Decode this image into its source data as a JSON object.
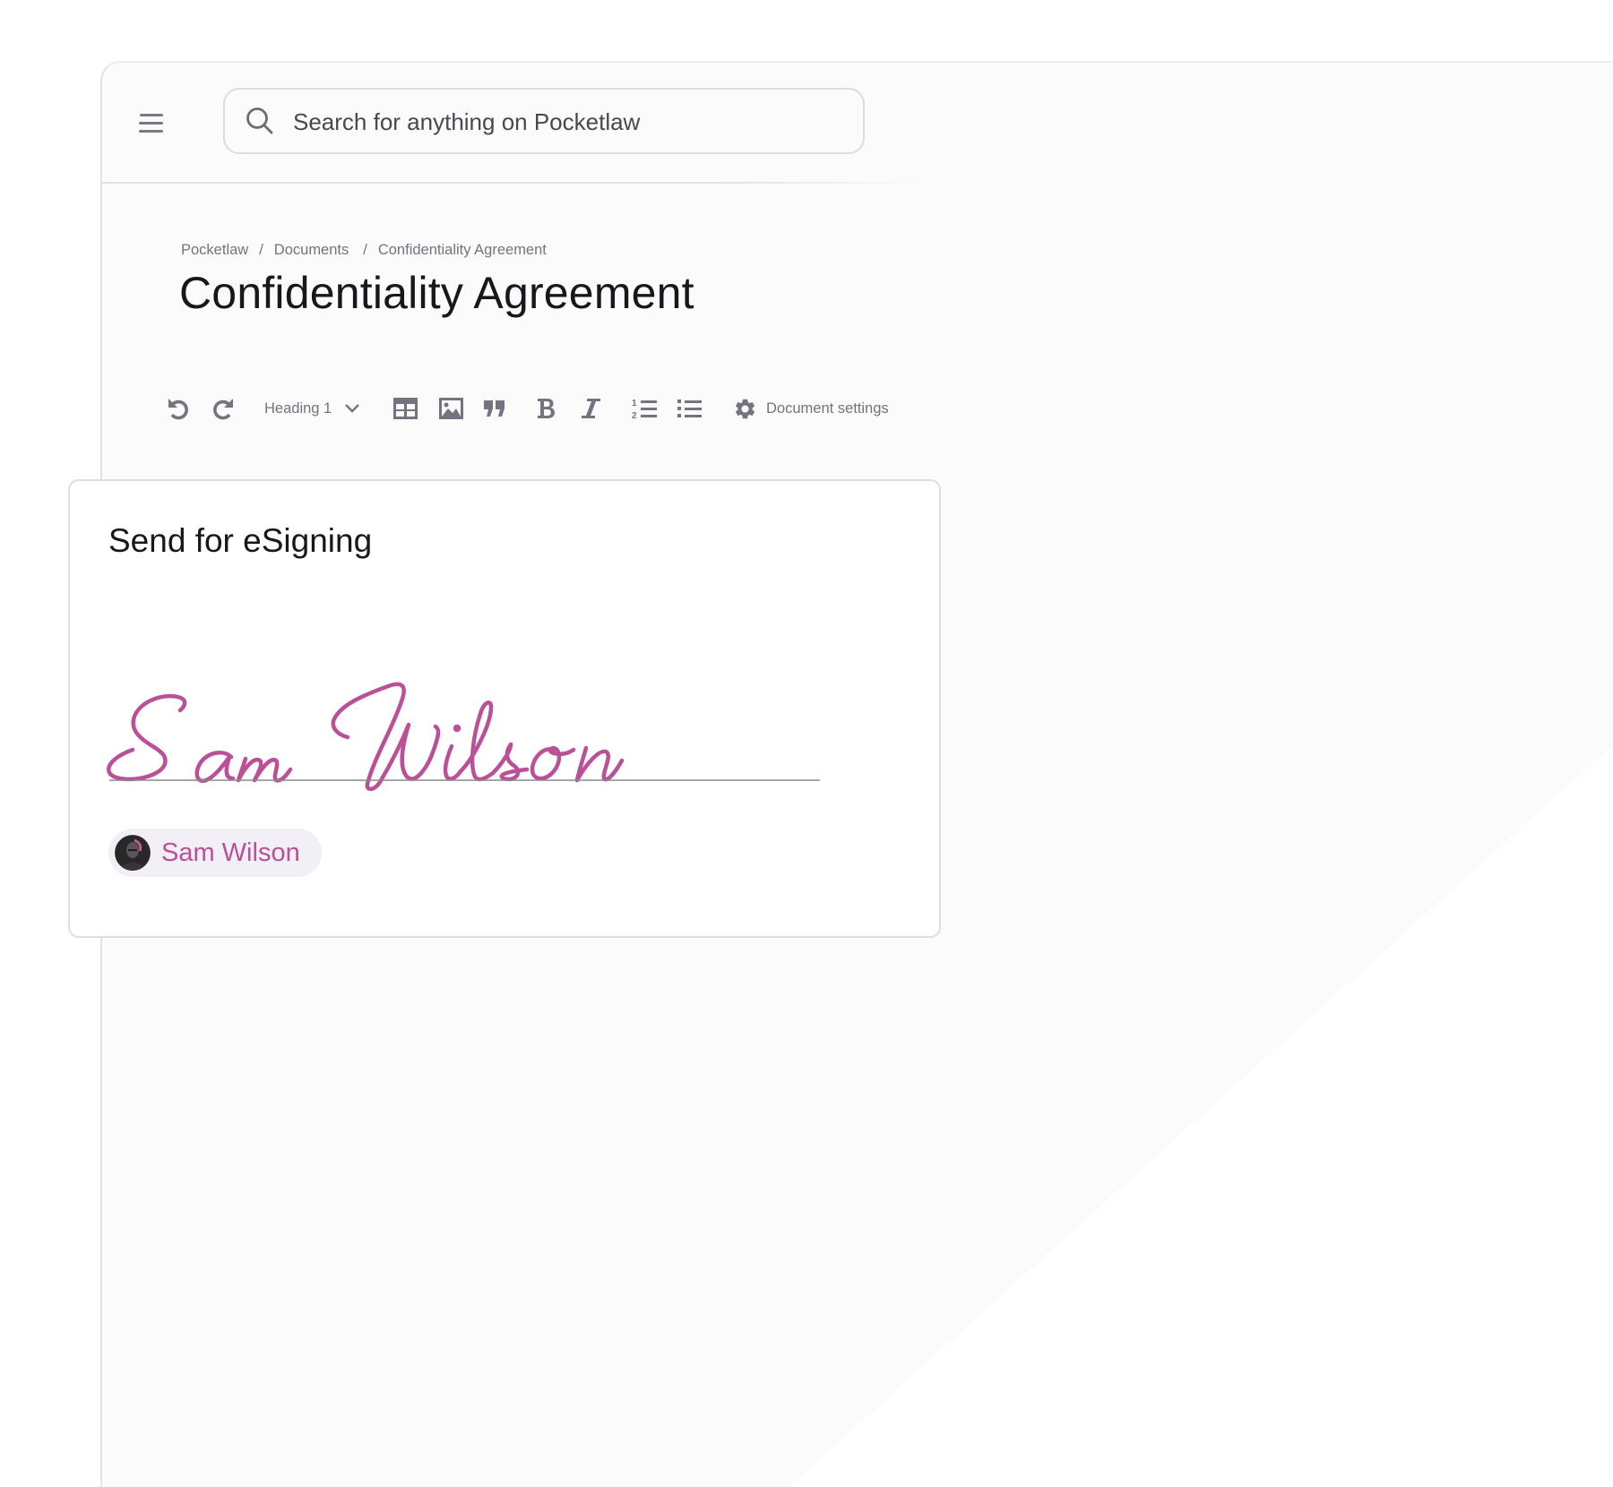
{
  "app": {
    "name": "Pocketlaw"
  },
  "colors": {
    "accent": "#BB4F98",
    "chip_background": "#F3EFF7",
    "icon_grey": "#76727F",
    "title_text": "#18171C",
    "window_background": "#FBFBFB"
  },
  "header": {
    "menu_icon": "hamburger-icon",
    "search": {
      "icon": "search-icon",
      "placeholder": "Search for anything on Pocketlaw",
      "value": ""
    }
  },
  "breadcrumb": {
    "items": [
      "Pocketlaw",
      "Documents",
      "Confidentiality Agreement"
    ],
    "separator": "/"
  },
  "page": {
    "title": "Confidentiality Agreement"
  },
  "toolbar": {
    "undo": "undo-icon",
    "redo": "redo-icon",
    "heading_select": {
      "value": "Heading 1",
      "icon": "chevron-down-icon"
    },
    "buttons": [
      "table-icon",
      "image-icon",
      "quote-icon",
      "bold-icon",
      "italic-icon",
      "ordered-list-icon",
      "bullet-list-icon"
    ],
    "document_settings": {
      "label": "Document settings",
      "icon": "gear-icon"
    }
  },
  "esign_card": {
    "title": "Send for eSigning",
    "signature_text": "Sam Wilson",
    "signer": {
      "name": "Sam Wilson",
      "avatar": "avatar-photo"
    }
  }
}
